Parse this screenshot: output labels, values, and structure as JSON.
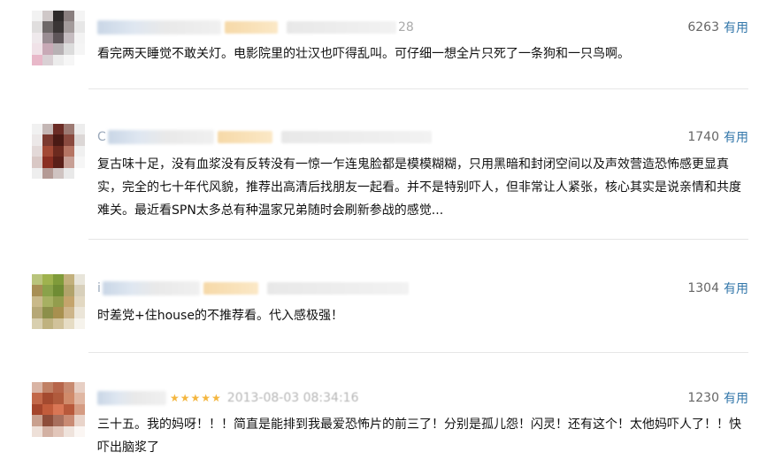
{
  "comments": [
    {
      "user_tail": "28",
      "votes": "6263",
      "vote_label": "有用",
      "text": "看完两天睡觉不敢关灯。电影院里的壮汉也吓得乱叫。可仔细一想全片只死了一条狗和一只鸟啊。"
    },
    {
      "user_head": "C",
      "votes": "1740",
      "vote_label": "有用",
      "text": "复古味十足，没有血浆没有反转没有一惊一乍连鬼脸都是模模糊糊，只用黑暗和封闭空间以及声效营造恐怖感更显真实，完全的七十年代风貌，推荐出高清后找朋友一起看。并不是特别吓人，但非常让人紧张，核心其实是说亲情和共度难关。最近看SPN太多总有种温家兄弟随时会刷新参战的感觉..."
    },
    {
      "user_head": "i",
      "votes": "1304",
      "vote_label": "有用",
      "text": "时差党+住house的不推荐看。代入感极强！"
    },
    {
      "stars": "★★★★★",
      "date": "2013-08-03 08:34:16",
      "votes": "1230",
      "vote_label": "有用",
      "text": "三十五。我的妈呀！！！简直是能排到我最爱恐怖片的前三了！分别是孤儿怨！闪灵！还有这个！太他妈吓人了！！快吓出脑浆了"
    }
  ]
}
